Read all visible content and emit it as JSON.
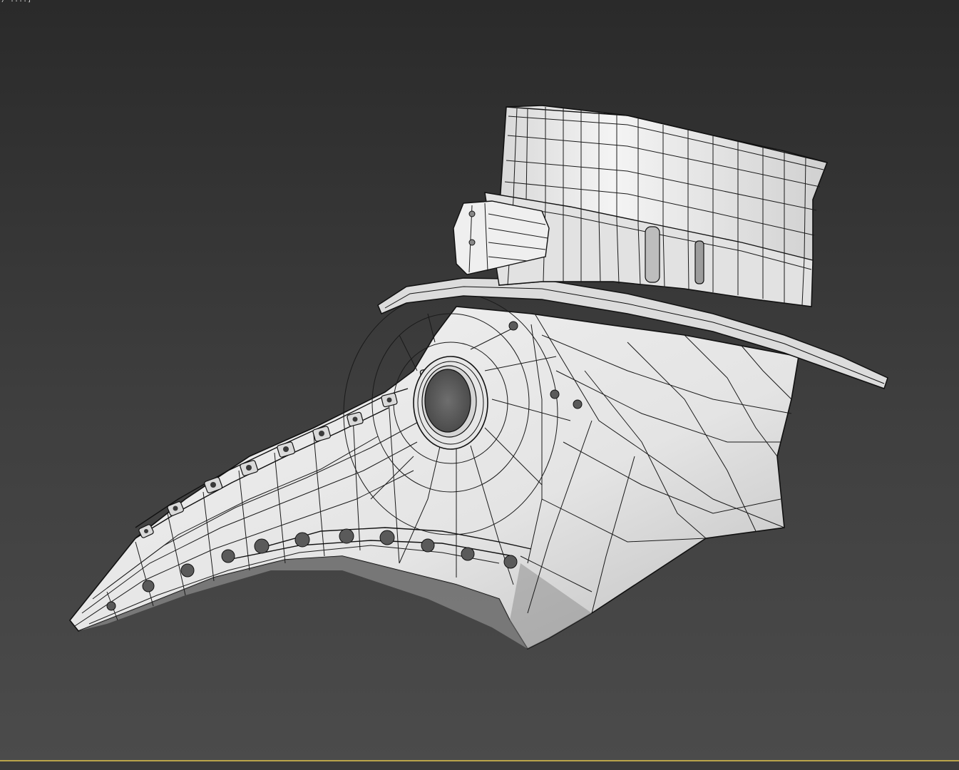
{
  "viewport": {
    "label": "/ ....]",
    "model": "plague-doctor-mask-wireframe",
    "shading": "wireframe-over-shaded"
  },
  "colors": {
    "background_top": "#2a2a2a",
    "background_bottom": "#4b4b4b",
    "mesh_fill": "#e9e9e9",
    "wire": "#1a1a1a",
    "active_viewport_border": "#b9a34a"
  }
}
